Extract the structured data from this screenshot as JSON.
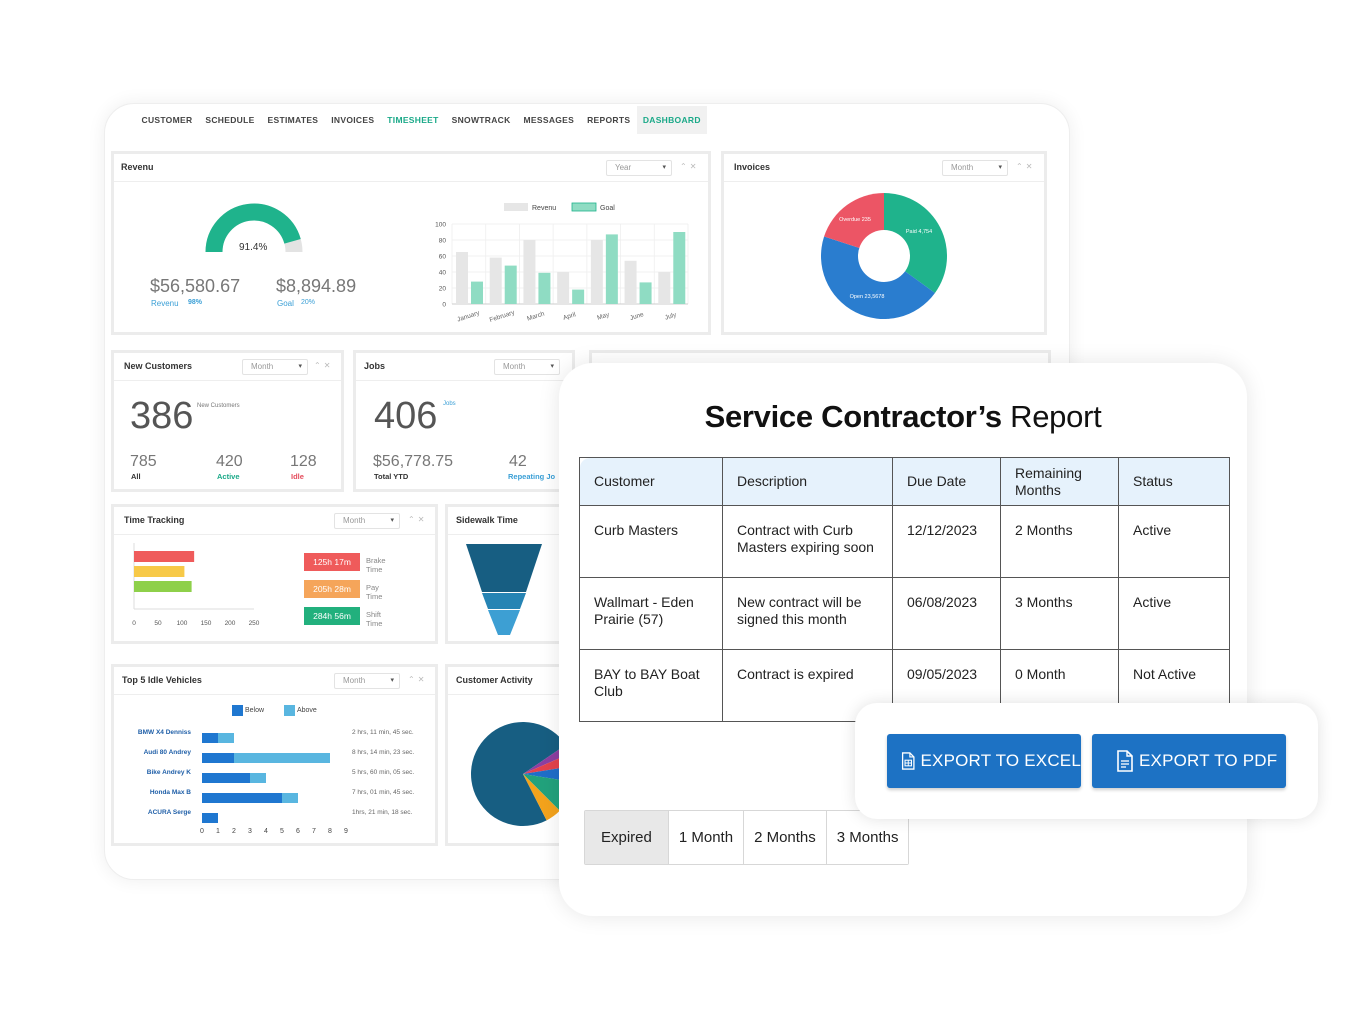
{
  "nav": [
    "CUSTOMER",
    "SCHEDULE",
    "ESTIMATES",
    "INVOICES",
    "TIMESHEET",
    "SNOWTRACK",
    "MESSAGES",
    "REPORTS",
    "DASHBOARD"
  ],
  "revenue": {
    "title": "Revenu",
    "period": "Year",
    "gauge_value": "91.4%",
    "gauge_fraction": 0.914,
    "revenue_amount": "$56,580.67",
    "revenue_label": "Revenu",
    "revenue_pct": "98%",
    "goal_amount": "$8,894.89",
    "goal_label": "Goal",
    "goal_pct": "20%"
  },
  "invoices": {
    "title": "Invoices",
    "period": "Month"
  },
  "new_customers": {
    "title": "New Customers",
    "period": "Month",
    "value": "386",
    "sub": "New Customers",
    "stats": [
      {
        "value": "785",
        "label": "All"
      },
      {
        "value": "420",
        "label": "Active"
      },
      {
        "value": "128",
        "label": "Idle"
      }
    ]
  },
  "jobs": {
    "title": "Jobs",
    "period": "Month",
    "value": "406",
    "sub": "Jobs",
    "amount": "$56,778.75",
    "amount_label": "Total YTD",
    "count": "42",
    "count_label": "Repeating Jo"
  },
  "time_tracking": {
    "title": "Time Tracking",
    "period": "Month",
    "legend": [
      {
        "value": "125h 17m",
        "label": "Brake Time",
        "color": "#ef5b5b"
      },
      {
        "value": "205h 28m",
        "label": "Pay Time",
        "color": "#f5a55a"
      },
      {
        "value": "284h 56m",
        "label": "Shift Time",
        "color": "#22b07d"
      }
    ],
    "ticks": [
      "0",
      "50",
      "100",
      "150",
      "200",
      "250"
    ]
  },
  "sidewalk": {
    "title": "Sidewalk Time"
  },
  "idle_vehicles": {
    "title": "Top 5 Idle Vehicles",
    "period": "Month",
    "legend_below": "Below",
    "legend_above": "Above",
    "rows": [
      {
        "name": "BMW X4 Denniss",
        "time": "2 hrs, 11 min, 45 sec."
      },
      {
        "name": "Audi 80 Andrey",
        "time": "8 hrs, 14 min, 23 sec."
      },
      {
        "name": "Bike Andrey K",
        "time": "5 hrs, 60 min, 05 sec."
      },
      {
        "name": "Honda Max B",
        "time": "7 hrs, 01 min, 45 sec."
      },
      {
        "name": "ACURA Serge",
        "time": "1hrs, 21 min, 18 sec."
      }
    ],
    "ticks": [
      "0",
      "1",
      "2",
      "3",
      "4",
      "5",
      "6",
      "7",
      "8",
      "9"
    ]
  },
  "customer_activity": {
    "title": "Customer Activity"
  },
  "report": {
    "title_bold": "Service Contractor’s",
    "title_rest": "Report",
    "headers": [
      "Customer",
      "Description",
      "Due Date",
      "Remaining Months",
      "Status"
    ],
    "rows": [
      [
        "Curb Masters",
        "Contract with Curb Masters expiring soon",
        "12/12/2023",
        "2 Months",
        "Active"
      ],
      [
        "Wallmart - Eden Prairie (57)",
        "New contract will be signed this month",
        "06/08/2023",
        "3 Months",
        "Active"
      ],
      [
        "BAY to BAY Boat Club",
        "Contract is expired",
        "09/05/2023",
        "0 Month",
        "Not Active"
      ]
    ],
    "filters": [
      "Expired",
      "1 Month",
      "2 Months",
      "3 Months"
    ]
  },
  "export": {
    "excel": "EXPORT TO EXCEL",
    "pdf": "EXPORT TO PDF"
  },
  "chart_data": [
    {
      "type": "bar",
      "title": "Revenu",
      "categories": [
        "January",
        "February",
        "March",
        "April",
        "May",
        "June",
        "July"
      ],
      "series": [
        {
          "name": "Revenu",
          "values": [
            65,
            58,
            80,
            40,
            80,
            54,
            40
          ],
          "color": "#e6e6e6"
        },
        {
          "name": "Goal",
          "values": [
            28,
            48,
            39,
            18,
            87,
            27,
            90
          ],
          "color": "#8fdcc3"
        }
      ],
      "ylim": [
        0,
        100
      ],
      "yticks": [
        "100",
        "80",
        "60",
        "40",
        "20",
        "0"
      ]
    },
    {
      "type": "pie",
      "title": "Invoices",
      "labels": [
        "Paid 4,754",
        "Open 23,5678",
        "Overdue 235"
      ],
      "values": [
        35,
        45,
        20
      ],
      "colors": [
        "#1fb38c",
        "#2a7dcf",
        "#ec5565"
      ]
    },
    {
      "type": "bar",
      "title": "Time Tracking",
      "categories": [
        "Brake Time",
        "Pay Time",
        "Shift Time"
      ],
      "values": [
        125.3,
        105,
        120
      ],
      "colors": [
        "#ef5b5b",
        "#f7c948",
        "#8ed04a"
      ],
      "xlim": [
        0,
        250
      ]
    },
    {
      "type": "bar",
      "title": "Top 5 Idle Vehicles",
      "categories": [
        "BMW X4 Denniss",
        "Audi 80 Andrey",
        "Bike Andrey K",
        "Honda Max B",
        "ACURA Serge"
      ],
      "series": [
        {
          "name": "Below",
          "values": [
            1,
            2,
            3,
            5,
            1
          ],
          "color": "#1f77d0"
        },
        {
          "name": "Above",
          "values": [
            2,
            8,
            4,
            6,
            0
          ],
          "color": "#59b6e0"
        }
      ],
      "xlim": [
        0,
        9
      ]
    },
    {
      "type": "pie",
      "title": "Customer Activity",
      "values": [
        73,
        5,
        10,
        5,
        4,
        3
      ],
      "colors": [
        "#175e82",
        "#f4a31c",
        "#22a27c",
        "#1f6ec9",
        "#e4424c",
        "#8d3fa1"
      ]
    }
  ]
}
